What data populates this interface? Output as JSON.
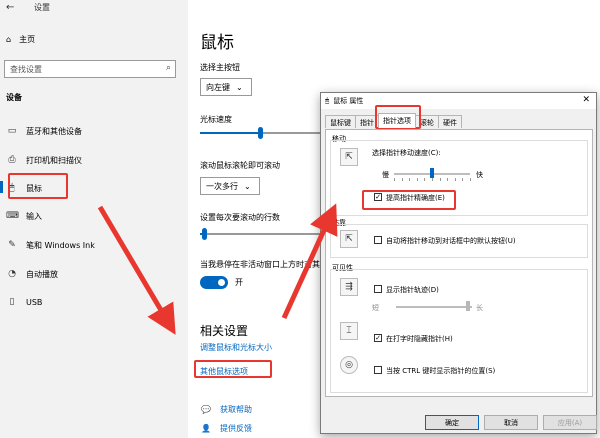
{
  "window": {
    "back_icon": "back-arrow-icon",
    "app_title": "设置"
  },
  "sidebar": {
    "home_label": "主页",
    "search_placeholder": "查找设置",
    "section_label": "设备",
    "items": [
      {
        "label": "蓝牙和其他设备",
        "icon": "bluetooth-icon"
      },
      {
        "label": "打印机和扫描仪",
        "icon": "printer-icon"
      },
      {
        "label": "鼠标",
        "icon": "mouse-icon",
        "selected": true
      },
      {
        "label": "输入",
        "icon": "keyboard-icon"
      },
      {
        "label": "笔和 Windows Ink",
        "icon": "pen-icon"
      },
      {
        "label": "自动播放",
        "icon": "autoplay-icon"
      },
      {
        "label": "USB",
        "icon": "usb-icon"
      }
    ]
  },
  "main": {
    "title": "鼠标",
    "primary_button_label": "选择主按钮",
    "primary_button_value": "向左键",
    "cursor_speed_label": "光标速度",
    "cursor_speed_level": 0.5,
    "scroll_label": "滚动鼠标滚轮即可滚动",
    "scroll_value": "一次多行",
    "lines_label": "设置每次要滚动的行数",
    "lines_level": 0.03,
    "inactive_scroll_label": "当我悬停在非活动窗口上方时对其进行滚动",
    "toggle_state": "开",
    "related_title": "相关设置",
    "link_adjust": "调整鼠标和光标大小",
    "link_other": "其他鼠标选项",
    "help_label": "获取帮助",
    "feedback_label": "提供反馈"
  },
  "dialog": {
    "title": "鼠标 属性",
    "close_label": "✕",
    "tabs": [
      "鼠标键",
      "指针",
      "指针选项",
      "滚轮",
      "硬件"
    ],
    "active_tab": "指针选项",
    "motion_title": "移动",
    "speed_label": "选择指针移动速度(C):",
    "slow_label": "慢",
    "fast_label": "快",
    "speed_level": 0.5,
    "enhance_label": "提高指针精确度(E)",
    "enhance_checked": true,
    "snap_title": "贴靠",
    "snap_label": "自动将指针移动到对话框中的默认按钮(U)",
    "snap_checked": false,
    "visibility_title": "可见性",
    "trails_label": "显示指针轨迹(D)",
    "trails_checked": false,
    "short_label": "短",
    "long_label": "长",
    "trails_level": 0.95,
    "hide_label": "在打字时隐藏指针(H)",
    "hide_checked": true,
    "ctrl_label": "当按 CTRL 键时显示指针的位置(S)",
    "ctrl_checked": false,
    "ok_label": "确定",
    "cancel_label": "取消",
    "apply_label": "应用(A)"
  },
  "colors": {
    "accent": "#0067c0",
    "highlight_red": "#e8372e"
  }
}
